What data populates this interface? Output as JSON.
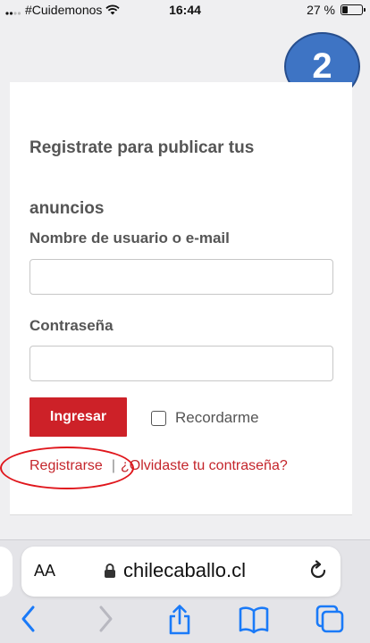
{
  "status_bar": {
    "carrier": "#Cuidemonos",
    "time": "16:44",
    "battery_text": "27 %",
    "battery_level": 0.27
  },
  "badge": {
    "step": "2"
  },
  "login": {
    "title": "Registrate para publicar tus anuncios",
    "username_label": "Nombre de usuario o e-mail",
    "username_value": "",
    "password_label": "Contraseña",
    "password_value": "",
    "submit_label": "Ingresar",
    "remember_label": "Recordarme",
    "remember_checked": false,
    "register_link": "Registrarse",
    "separator": "|",
    "forgot_link": "¿Olvidaste tu contraseña?"
  },
  "browser": {
    "text_size_label": "AA",
    "url": "chilecaballo.cl",
    "toolbar": [
      "back-icon",
      "forward-icon",
      "share-icon",
      "bookmarks-icon",
      "tabs-icon"
    ]
  },
  "colors": {
    "accent": "#cd2128",
    "badge": "#3e74c4",
    "ios_blue": "#1a7af8"
  }
}
